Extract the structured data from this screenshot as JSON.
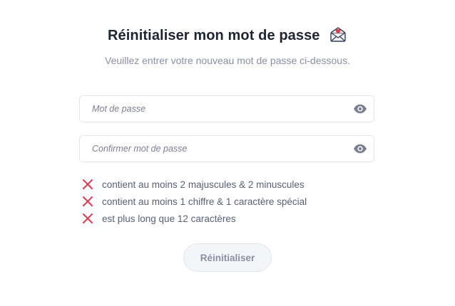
{
  "header": {
    "title": "Réinitialiser mon mot de passe",
    "title_icon": "envelope-heart-icon",
    "subtitle": "Veuillez entrer votre nouveau mot de passe ci-dessous."
  },
  "form": {
    "password": {
      "placeholder": "Mot de passe",
      "value": "",
      "toggle_icon": "eye-icon"
    },
    "confirm_password": {
      "placeholder": "Confirmer mot de passe",
      "value": "",
      "toggle_icon": "eye-icon"
    },
    "rules": [
      {
        "text": "contient au moins 2 majuscules & 2 minuscules",
        "status": "invalid",
        "icon": "cross-icon"
      },
      {
        "text": "contient au moins 1 chiffre & 1 caractère spécial",
        "status": "invalid",
        "icon": "cross-icon"
      },
      {
        "text": "est plus long que 12 caractères",
        "status": "invalid",
        "icon": "cross-icon"
      }
    ],
    "submit_label": "Réinitialiser"
  },
  "colors": {
    "title": "#1f2433",
    "muted": "#8a8fa3",
    "error": "#e0384b",
    "border": "#e3e5ec",
    "button_bg": "#f4f5f9"
  }
}
